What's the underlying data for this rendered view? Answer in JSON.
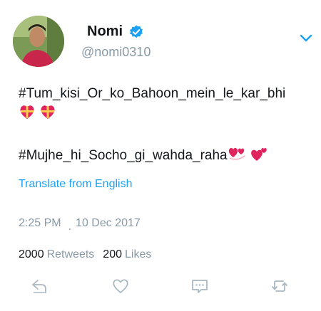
{
  "user": {
    "name": "Nomi",
    "handle": "@nomi0310"
  },
  "tweet": {
    "line1": "#Tum_kisi_Or_ko_Bahoon_mein_le_kar_bhi",
    "line3": "#Mujhe_hi_Socho_gi_wahda_raha"
  },
  "translate_label": "Translate from English",
  "meta": {
    "time": "2:25 PM",
    "separator": ".",
    "date": "10 Dec 2017"
  },
  "stats": {
    "retweets_count": "2000",
    "retweets_label": "Retweets",
    "likes_count": "200",
    "likes_label": "Likes"
  },
  "icons": {
    "verified": "verified-badge-icon",
    "more": "chevron-down-icon",
    "reply": "reply-icon",
    "like": "heart-icon",
    "message": "message-icon",
    "retweet": "retweet-icon"
  },
  "colors": {
    "accent": "#1da1f2",
    "muted": "#8899a6",
    "text": "#14171a"
  }
}
